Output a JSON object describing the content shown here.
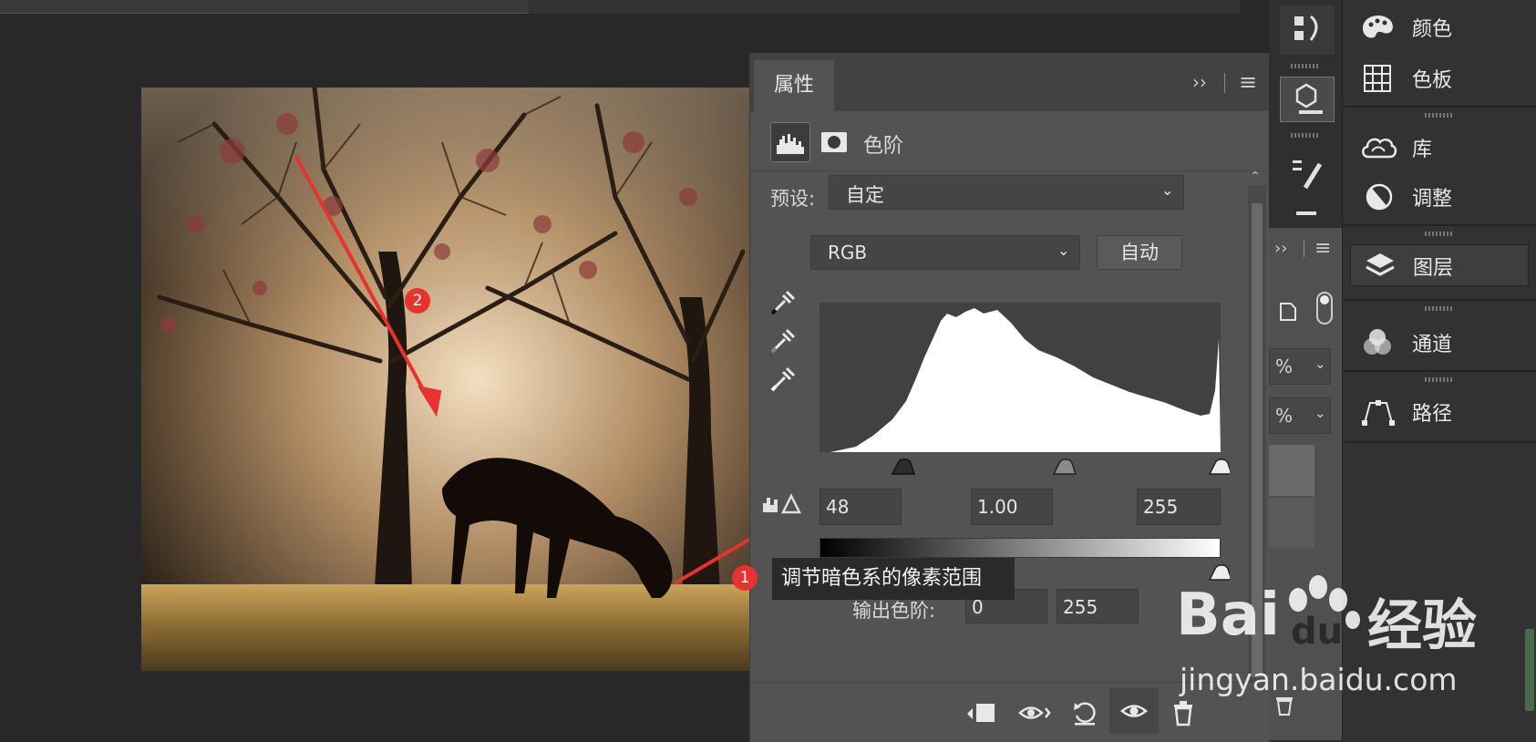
{
  "properties_panel": {
    "tab_label": "属性",
    "expand_glyph": "››",
    "menu_glyph": "≡",
    "adjustment_type_label": "色阶",
    "preset_label": "预设:",
    "preset_value": "自定",
    "channel_value": "RGB",
    "auto_button_label": "自动",
    "input_black": "48",
    "input_gamma": "1.00",
    "input_white": "255",
    "output_label": "输出色阶:",
    "output_black": "0",
    "output_white": "255"
  },
  "right_panels": {
    "items": [
      {
        "label": "颜色",
        "icon": "palette-icon"
      },
      {
        "label": "色板",
        "icon": "swatches-grid-icon"
      },
      {
        "label": "库",
        "icon": "libraries-cloud-icon"
      },
      {
        "label": "调整",
        "icon": "adjustments-half-circle-icon"
      },
      {
        "label": "图层",
        "icon": "layers-icon",
        "active": true
      },
      {
        "label": "通道",
        "icon": "channels-icon"
      },
      {
        "label": "路径",
        "icon": "paths-icon"
      }
    ]
  },
  "middle_column": {
    "pct_1": "%",
    "pct_2": "%"
  },
  "annotations": {
    "badge_1": "1",
    "badge_2": "2",
    "tooltip_text": "调节暗色系的像素范围",
    "arrow_color": "#e8322e"
  },
  "watermark": {
    "brand_left": "Bai",
    "brand_du": "du",
    "brand_right": "经验",
    "url": "jingyan.baidu.com"
  },
  "colors": {
    "panel_bg": "#535353",
    "panel_dark": "#424242",
    "accent_red": "#e8322e"
  }
}
